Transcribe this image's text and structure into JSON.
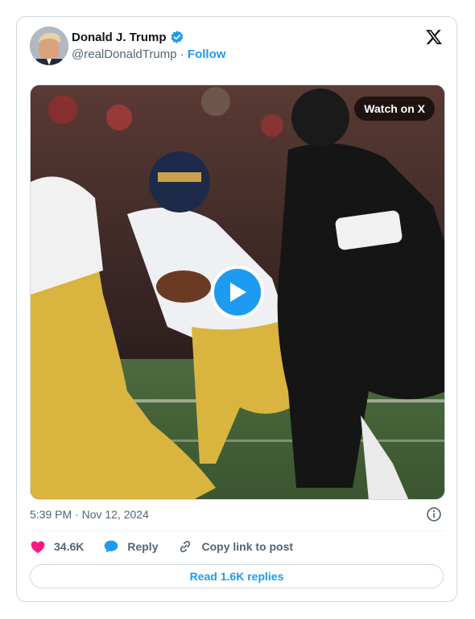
{
  "author": {
    "name": "Donald J. Trump",
    "handle": "@realDonaldTrump",
    "separator": "·",
    "follow_label": "Follow"
  },
  "media": {
    "watch_label": "Watch on X"
  },
  "meta": {
    "timestamp": "5:39 PM · Nov 12, 2024"
  },
  "actions": {
    "likes": "34.6K",
    "reply_label": "Reply",
    "copy_label": "Copy link to post"
  },
  "replies_button": "Read 1.6K replies",
  "colors": {
    "accent": "#1d9bf0",
    "like": "#f91880",
    "text": "#0f1419",
    "muted": "#536471",
    "border": "#cfd9de"
  }
}
